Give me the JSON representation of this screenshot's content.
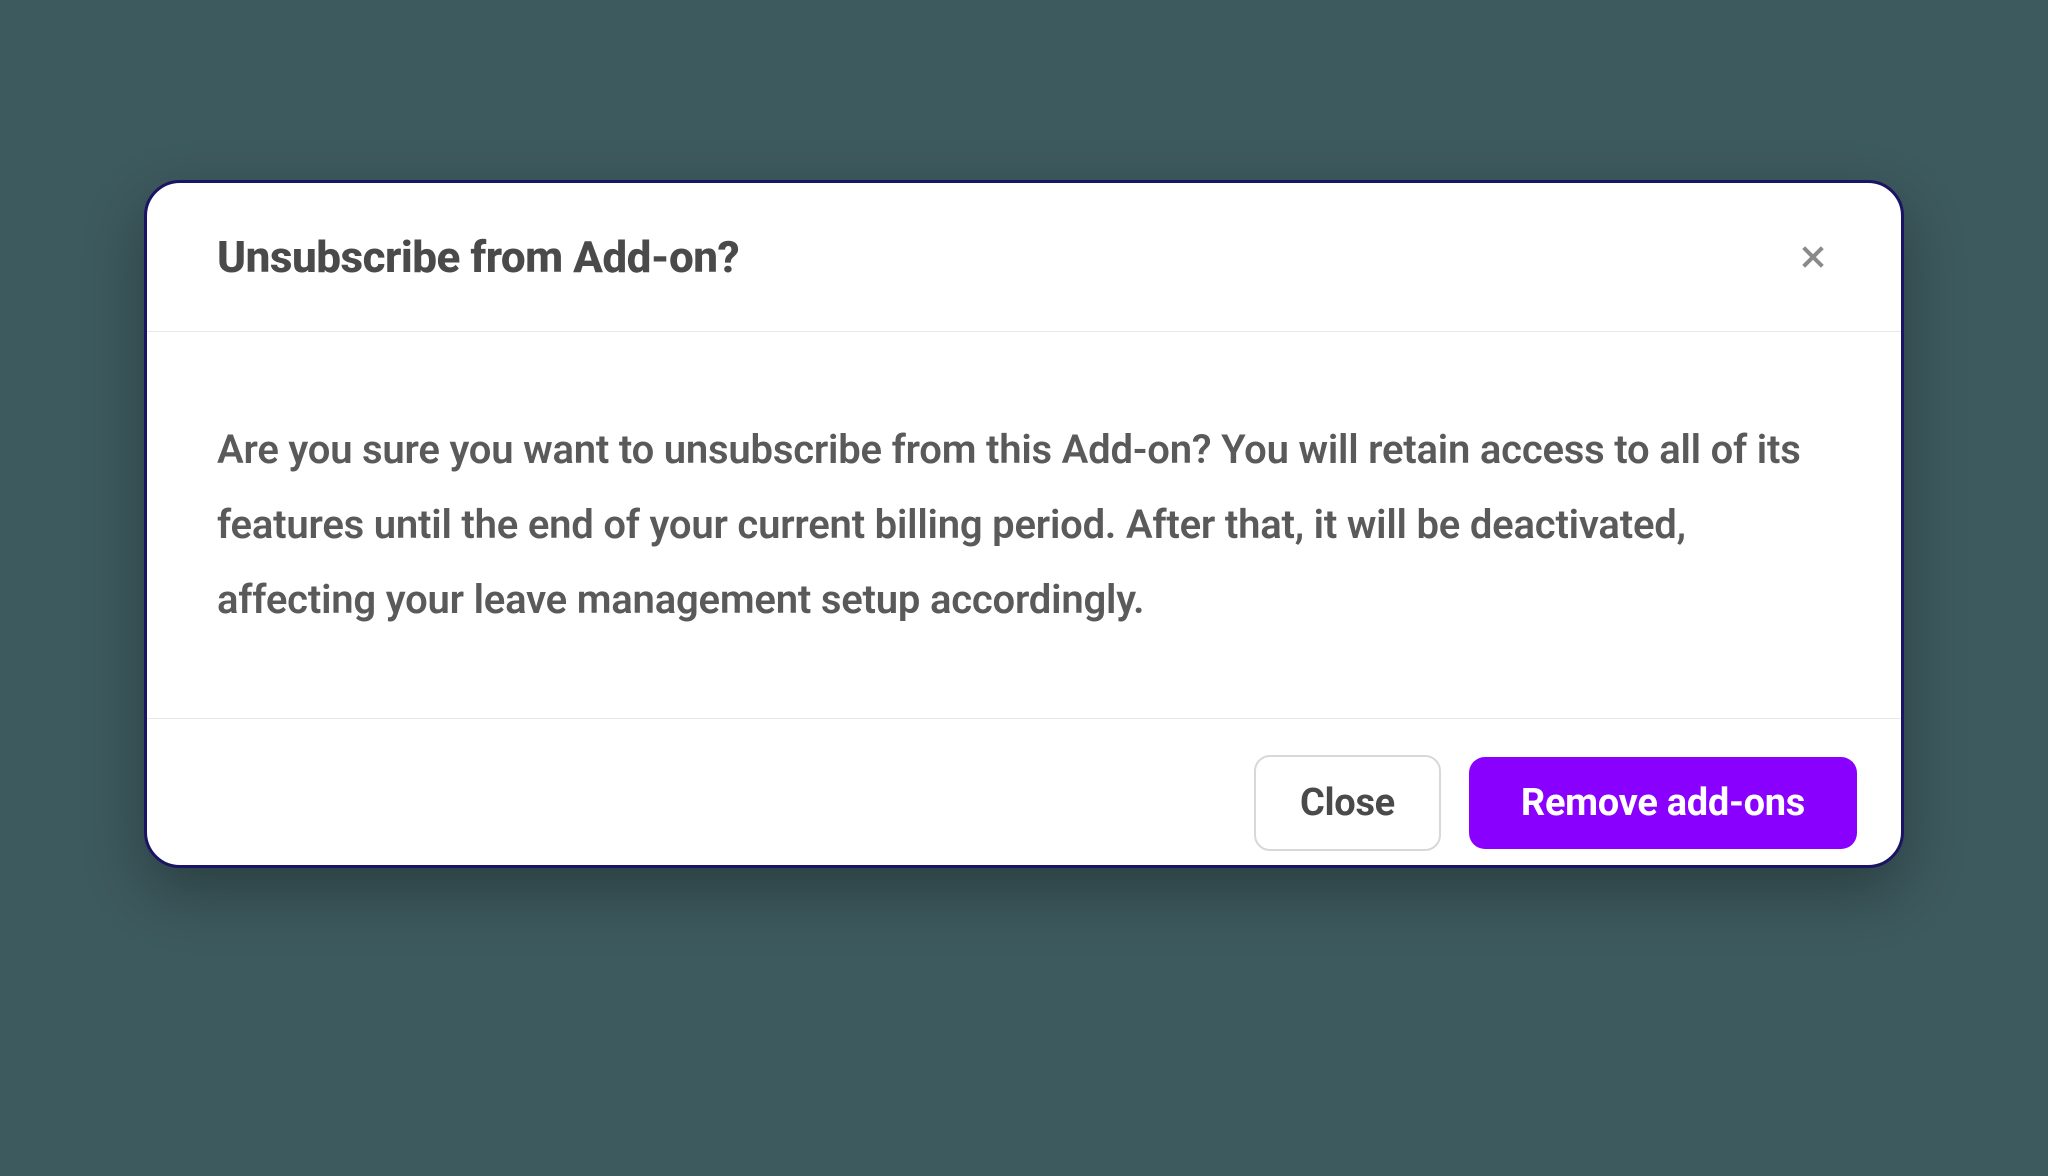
{
  "modal": {
    "title": "Unsubscribe from Add-on?",
    "body_text": "Are you sure you want to unsubscribe from this Add-on? You will retain access to all of its features until the end of your current billing period. After that, it will be deactivated, affecting your leave management setup accordingly.",
    "close_button_label": "Close",
    "remove_button_label": "Remove add-ons"
  }
}
